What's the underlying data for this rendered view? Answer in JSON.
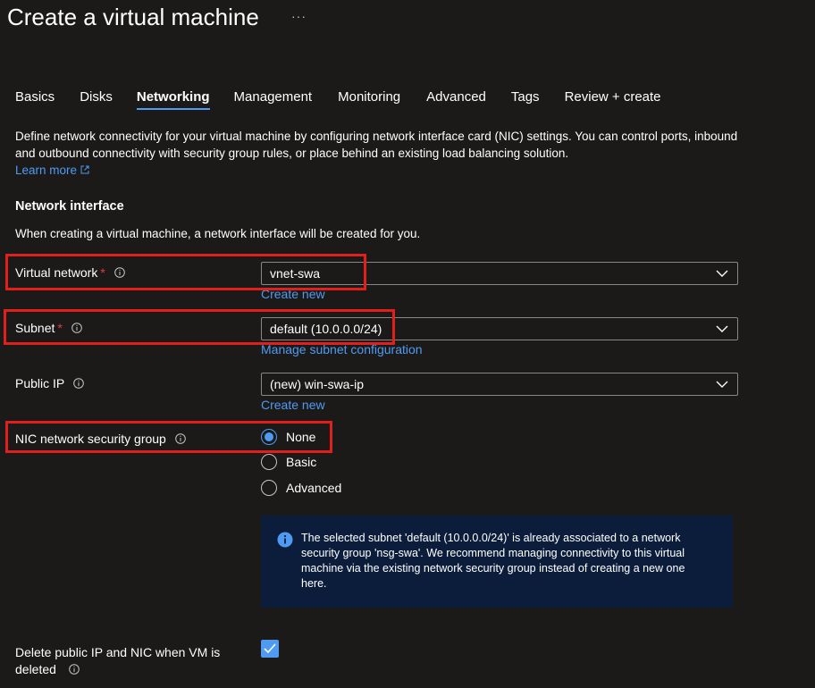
{
  "page": {
    "title": "Create a virtual machine",
    "more_label": "···"
  },
  "tabs": [
    {
      "label": "Basics",
      "active": false
    },
    {
      "label": "Disks",
      "active": false
    },
    {
      "label": "Networking",
      "active": true
    },
    {
      "label": "Management",
      "active": false
    },
    {
      "label": "Monitoring",
      "active": false
    },
    {
      "label": "Advanced",
      "active": false
    },
    {
      "label": "Tags",
      "active": false
    },
    {
      "label": "Review + create",
      "active": false
    }
  ],
  "description": {
    "text": "Define network connectivity for your virtual machine by configuring network interface card (NIC) settings. You can control ports, inbound and outbound connectivity with security group rules, or place behind an existing load balancing solution.",
    "learn_more": "Learn more"
  },
  "network_interface": {
    "title": "Network interface",
    "subtitle": "When creating a virtual machine, a network interface will be created for you."
  },
  "fields": {
    "virtual_network": {
      "label": "Virtual network",
      "required": "*",
      "value": "vnet-swa",
      "link": "Create new"
    },
    "subnet": {
      "label": "Subnet",
      "required": "*",
      "value": "default (10.0.0.0/24)",
      "link": "Manage subnet configuration"
    },
    "public_ip": {
      "label": "Public IP",
      "value": "(new) win-swa-ip",
      "link": "Create new"
    },
    "nsg": {
      "label": "NIC network security group",
      "options": [
        "None",
        "Basic",
        "Advanced"
      ],
      "selected": "None"
    }
  },
  "info_box": {
    "text": "The selected subnet 'default (10.0.0.0/24)' is already associated to a network security group 'nsg-swa'. We recommend managing connectivity to this virtual machine via the existing network security group instead of creating a new one here."
  },
  "delete_option": {
    "label": "Delete public IP and NIC when VM is deleted",
    "checked": true
  },
  "colors": {
    "background": "#1b1a19",
    "link": "#4f9bf1",
    "highlight": "#e0201b",
    "required": "#e83a3a",
    "info_bg": "#0b1d3b"
  }
}
